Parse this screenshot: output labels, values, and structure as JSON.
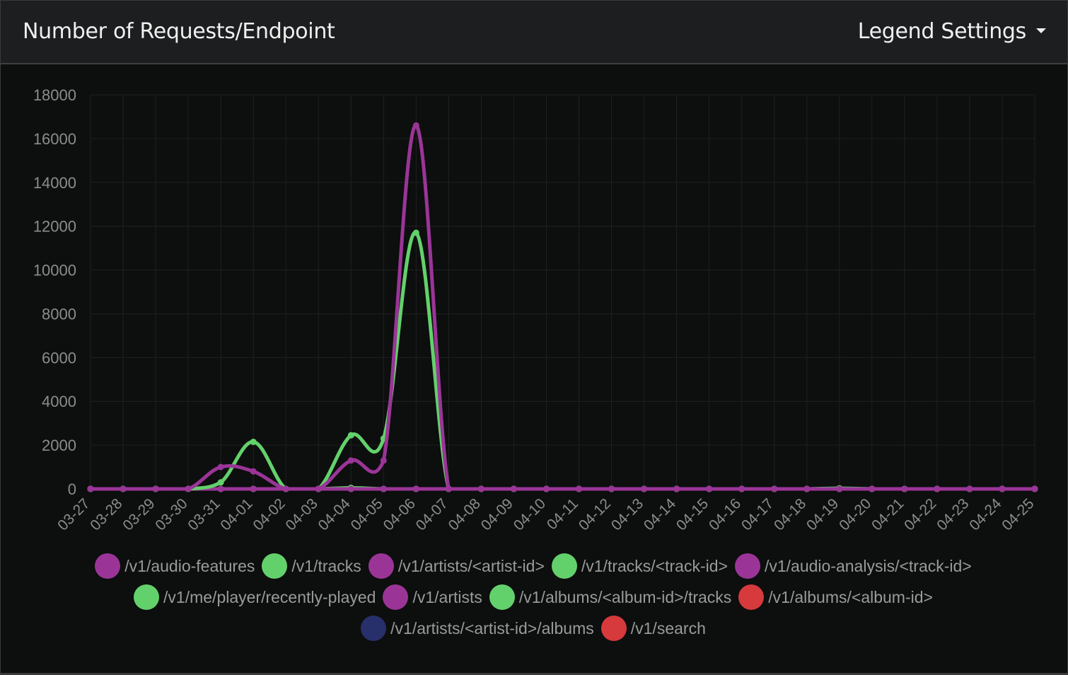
{
  "header": {
    "title": "Number of Requests/Endpoint",
    "legend_settings_label": "Legend Settings"
  },
  "colors": {
    "purple": "#9a3597",
    "green": "#63d16b",
    "red": "#d63a3c",
    "navy": "#27306a",
    "grid": "#202020",
    "tick": "#8c8c8c"
  },
  "chart_data": {
    "type": "line",
    "title": "Number of Requests/Endpoint",
    "ylim": [
      0,
      18000
    ],
    "yticks": [
      0,
      2000,
      4000,
      6000,
      8000,
      10000,
      12000,
      14000,
      16000,
      18000
    ],
    "categories": [
      "03-27",
      "03-28",
      "03-29",
      "03-30",
      "03-31",
      "04-01",
      "04-02",
      "04-03",
      "04-04",
      "04-05",
      "04-06",
      "04-07",
      "04-08",
      "04-09",
      "04-10",
      "04-11",
      "04-12",
      "04-13",
      "04-14",
      "04-15",
      "04-16",
      "04-17",
      "04-18",
      "04-19",
      "04-20",
      "04-21",
      "04-22",
      "04-23",
      "04-24",
      "04-25"
    ],
    "grid": true,
    "legend_position": "bottom",
    "series": [
      {
        "name": "/v1/audio-features",
        "color": "#9a3597",
        "values": [
          0,
          0,
          0,
          0,
          1000,
          800,
          0,
          0,
          1300,
          1300,
          16600,
          0,
          0,
          0,
          0,
          0,
          0,
          0,
          0,
          0,
          0,
          0,
          0,
          0,
          0,
          0,
          0,
          0,
          0,
          0
        ]
      },
      {
        "name": "/v1/tracks",
        "color": "#63d16b",
        "values": [
          0,
          0,
          0,
          0,
          300,
          2150,
          0,
          0,
          2450,
          2300,
          11700,
          0,
          0,
          0,
          0,
          0,
          0,
          0,
          0,
          0,
          0,
          0,
          0,
          0,
          0,
          0,
          0,
          0,
          0,
          0
        ]
      },
      {
        "name": "/v1/artists/<artist-id>",
        "color": "#9a3597",
        "values": [
          0,
          0,
          0,
          0,
          0,
          0,
          0,
          0,
          0,
          0,
          0,
          0,
          0,
          0,
          0,
          0,
          0,
          0,
          0,
          0,
          0,
          0,
          0,
          0,
          0,
          0,
          0,
          0,
          0,
          0
        ]
      },
      {
        "name": "/v1/tracks/<track-id>",
        "color": "#63d16b",
        "values": [
          0,
          0,
          0,
          0,
          0,
          0,
          0,
          0,
          50,
          0,
          0,
          0,
          0,
          0,
          0,
          0,
          0,
          0,
          0,
          0,
          0,
          0,
          0,
          30,
          0,
          0,
          0,
          0,
          0,
          0
        ]
      },
      {
        "name": "/v1/audio-analysis/<track-id>",
        "color": "#9a3597",
        "values": [
          0,
          0,
          0,
          0,
          0,
          0,
          0,
          0,
          0,
          0,
          0,
          0,
          0,
          0,
          0,
          0,
          0,
          0,
          0,
          0,
          0,
          0,
          0,
          0,
          0,
          0,
          0,
          0,
          0,
          0
        ]
      },
      {
        "name": "/v1/me/player/recently-played",
        "color": "#63d16b",
        "values": [
          0,
          0,
          0,
          0,
          0,
          0,
          0,
          0,
          0,
          0,
          0,
          0,
          0,
          0,
          0,
          0,
          0,
          0,
          0,
          0,
          0,
          0,
          0,
          0,
          0,
          0,
          0,
          0,
          0,
          0
        ]
      },
      {
        "name": "/v1/artists",
        "color": "#9a3597",
        "values": [
          0,
          0,
          0,
          0,
          0,
          0,
          0,
          0,
          0,
          0,
          0,
          0,
          0,
          0,
          0,
          0,
          0,
          0,
          0,
          0,
          0,
          0,
          0,
          0,
          0,
          0,
          0,
          0,
          0,
          0
        ]
      },
      {
        "name": "/v1/albums/<album-id>/tracks",
        "color": "#63d16b",
        "values": [
          0,
          0,
          0,
          0,
          0,
          0,
          0,
          0,
          0,
          0,
          0,
          0,
          0,
          0,
          0,
          0,
          0,
          0,
          0,
          0,
          0,
          0,
          0,
          0,
          0,
          0,
          0,
          0,
          0,
          0
        ]
      },
      {
        "name": "/v1/albums/<album-id>",
        "color": "#d63a3c",
        "values": [
          0,
          0,
          0,
          0,
          0,
          0,
          0,
          0,
          0,
          0,
          0,
          0,
          0,
          0,
          0,
          0,
          0,
          0,
          0,
          0,
          0,
          0,
          0,
          0,
          0,
          0,
          0,
          0,
          0,
          0
        ]
      },
      {
        "name": "/v1/artists/<artist-id>/albums",
        "color": "#27306a",
        "values": [
          0,
          0,
          0,
          0,
          0,
          0,
          0,
          0,
          0,
          0,
          0,
          0,
          0,
          0,
          0,
          0,
          0,
          0,
          0,
          0,
          0,
          0,
          0,
          0,
          0,
          0,
          0,
          0,
          0,
          0
        ]
      },
      {
        "name": "/v1/search",
        "color": "#d63a3c",
        "values": [
          0,
          0,
          0,
          0,
          0,
          0,
          0,
          0,
          0,
          0,
          0,
          0,
          0,
          0,
          0,
          0,
          0,
          0,
          0,
          0,
          0,
          0,
          0,
          0,
          0,
          0,
          0,
          0,
          0,
          0
        ]
      }
    ]
  },
  "legend_rows": [
    [
      0,
      1,
      2,
      3,
      4
    ],
    [
      5,
      6,
      7,
      8
    ],
    [
      9,
      10
    ]
  ]
}
